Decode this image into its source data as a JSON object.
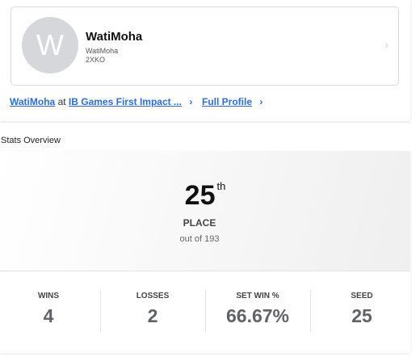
{
  "player": {
    "avatar_letter": "W",
    "name": "WatiMoha",
    "handle": "WatiMoha",
    "game": "2XKO"
  },
  "links": {
    "player_link": "WatiMoha",
    "at_text": "at",
    "event_link": "IB Games First Impact ...",
    "profile_link": "Full Profile"
  },
  "stats_overview": {
    "section_title": "Stats Overview",
    "place": "25",
    "place_suffix": "th",
    "place_label": "PLACE",
    "out_of": "out of 193",
    "stats": [
      {
        "label": "WINS",
        "value": "4"
      },
      {
        "label": "LOSSES",
        "value": "2"
      },
      {
        "label": "SET WIN %",
        "value": "66.67%"
      },
      {
        "label": "SEED",
        "value": "25"
      }
    ]
  },
  "icons": {
    "chevron": "›"
  }
}
